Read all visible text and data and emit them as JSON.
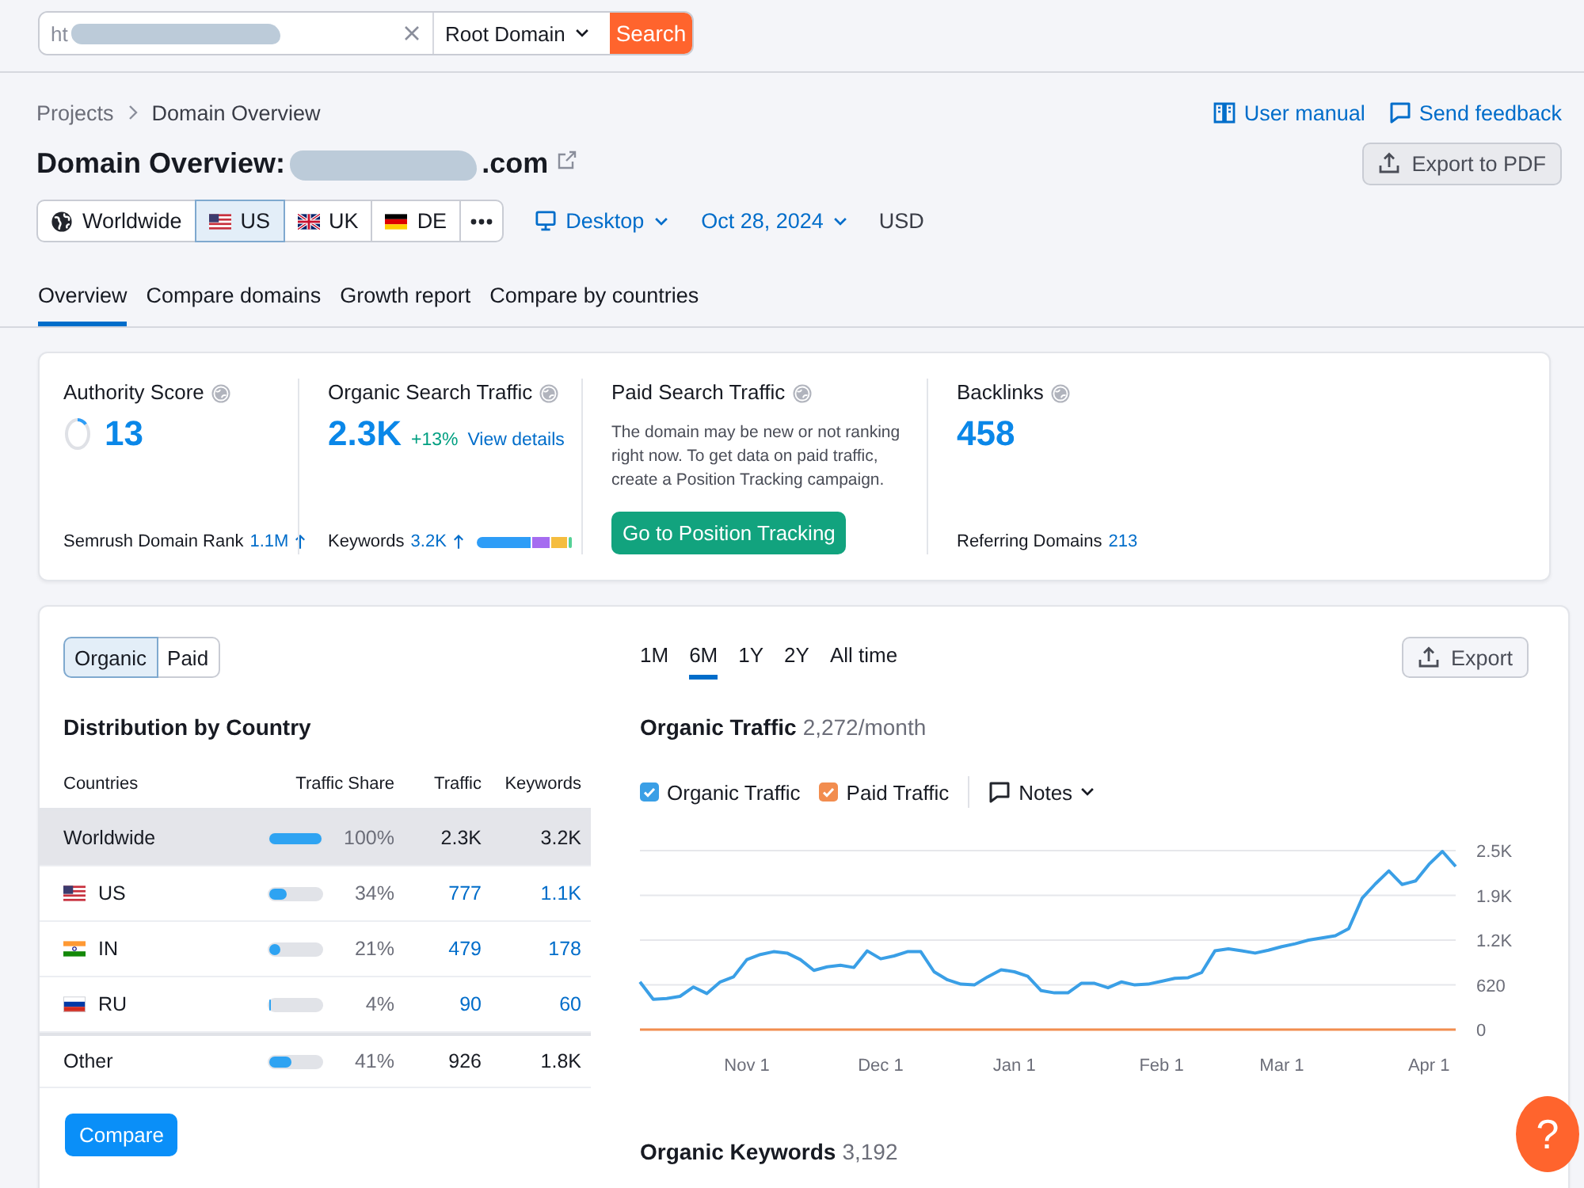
{
  "search_bar": {
    "value": "ht",
    "scope": "Root Domain",
    "button": "Search"
  },
  "header": {
    "breadcrumbs": [
      "Projects",
      "Domain Overview"
    ],
    "user_manual": "User manual",
    "send_feedback": "Send feedback",
    "export_pdf": "Export to PDF",
    "title": "Domain Overview:",
    "domain_suffix": ".com",
    "databases": [
      {
        "label": "Worldwide",
        "kind": "globe",
        "selected": false
      },
      {
        "label": "US",
        "kind": "us",
        "selected": true
      },
      {
        "label": "UK",
        "kind": "uk",
        "selected": false
      },
      {
        "label": "DE",
        "kind": "de",
        "selected": false
      }
    ],
    "device": "Desktop",
    "date": "Oct 28, 2024",
    "currency": "USD"
  },
  "tabs": [
    {
      "label": "Overview",
      "selected": true
    },
    {
      "label": "Compare domains",
      "selected": false
    },
    {
      "label": "Growth report",
      "selected": false
    },
    {
      "label": "Compare by countries",
      "selected": false
    }
  ],
  "metrics": [
    {
      "kind": "score",
      "label": "Authority Score",
      "value": "13",
      "level": 0.13,
      "footer": {
        "label": "Semrush Domain Rank",
        "value": "1.1M",
        "rising": true
      }
    },
    {
      "kind": "traffic",
      "label": "Organic Search Traffic",
      "value": "2.3K",
      "change": "+13%",
      "link": "View details",
      "footer": {
        "label": "Keywords",
        "value": "3.2K",
        "rising": true
      }
    },
    {
      "kind": "notice",
      "label": "Paid Search Traffic",
      "description": "The domain may be new or not ranking right now. To get data on paid traffic, create a Position Tracking campaign.",
      "button": "Go to Position Tracking"
    },
    {
      "kind": "count",
      "label": "Backlinks",
      "value": "458",
      "footer": {
        "label": "Referring Domains",
        "value": "213"
      }
    }
  ],
  "distribution": {
    "toggle": [
      {
        "label": "Organic",
        "selected": true
      },
      {
        "label": "Paid",
        "selected": false
      }
    ],
    "title": "Distribution by Country",
    "columns": [
      "Countries",
      "Traffic Share",
      "Traffic",
      "Keywords"
    ],
    "rows": [
      {
        "kind": "total",
        "country": "Worldwide",
        "level": 1.0,
        "share": "100%",
        "traffic": "2.3K",
        "keywords": "3.2K",
        "selected": true
      },
      {
        "kind": "us",
        "country": "US",
        "level": 0.34,
        "share": "34%",
        "traffic": "777",
        "keywords": "1.1K",
        "selected": false
      },
      {
        "kind": "in",
        "country": "IN",
        "level": 0.21,
        "share": "21%",
        "traffic": "479",
        "keywords": "178",
        "selected": false
      },
      {
        "kind": "ru",
        "country": "RU",
        "level": 0.04,
        "share": "4%",
        "traffic": "90",
        "keywords": "60",
        "selected": false
      },
      {
        "kind": "other",
        "country": "Other",
        "level": 0.41,
        "share": "41%",
        "traffic": "926",
        "keywords": "1.8K",
        "selected": false
      }
    ],
    "compare_button": "Compare"
  },
  "traffic_panel": {
    "periods": [
      {
        "label": "1M",
        "selected": false
      },
      {
        "label": "6M",
        "selected": true
      },
      {
        "label": "1Y",
        "selected": false
      },
      {
        "label": "2Y",
        "selected": false
      },
      {
        "label": "All time",
        "selected": false
      }
    ],
    "export": "Export",
    "title": "Organic Traffic",
    "summary": "2,272/month",
    "legend": [
      {
        "checked": true
      },
      {
        "checked": true
      }
    ],
    "notes": "Notes",
    "chart_data": {
      "type": "line",
      "grid": true,
      "categories": [
        null,
        null,
        null,
        null,
        null,
        null,
        null,
        null,
        "Nov 1",
        null,
        null,
        null,
        null,
        null,
        null,
        null,
        null,
        null,
        "Dec 1",
        null,
        null,
        null,
        null,
        null,
        null,
        null,
        null,
        null,
        "Jan 1",
        null,
        null,
        null,
        null,
        null,
        null,
        null,
        null,
        null,
        null,
        "Feb 1",
        null,
        null,
        null,
        null,
        null,
        null,
        null,
        null,
        "Mar 1",
        null,
        null,
        null,
        null,
        null,
        null,
        null,
        null,
        null,
        null,
        "Apr 1",
        null,
        null
      ],
      "series": [
        {
          "name": "Organic Traffic",
          "color": "#3a9fe6",
          "values": [
            660,
            420,
            430,
            460,
            590,
            500,
            660,
            730,
            970,
            1040,
            1080,
            1060,
            970,
            820,
            870,
            890,
            860,
            1090,
            980,
            1020,
            1080,
            1080,
            800,
            690,
            630,
            620,
            730,
            830,
            800,
            740,
            540,
            510,
            510,
            640,
            640,
            580,
            660,
            620,
            630,
            670,
            710,
            720,
            790,
            1090,
            1120,
            1090,
            1060,
            1100,
            1150,
            1190,
            1240,
            1270,
            1300,
            1400,
            1820,
            2020,
            2200,
            2010,
            2060,
            2290,
            2470,
            2260
          ]
        },
        {
          "name": "Paid Traffic",
          "color": "#f28d4f",
          "values": [
            0,
            0,
            0,
            0,
            0,
            0,
            0,
            0,
            0,
            0,
            0,
            0,
            0,
            0,
            0,
            0,
            0,
            0,
            0,
            0,
            0,
            0,
            0,
            0,
            0,
            0,
            0,
            0,
            0,
            0,
            0,
            0,
            0,
            0,
            0,
            0,
            0,
            0,
            0,
            0,
            0,
            0,
            0,
            0,
            0,
            0,
            0,
            0,
            0,
            0,
            0,
            0,
            0,
            0,
            0,
            0,
            0,
            0,
            0,
            0,
            0,
            0
          ]
        }
      ],
      "ylim": [
        0,
        2480
      ],
      "yticks": [
        {
          "value": 0,
          "label": "0"
        },
        {
          "value": 620,
          "label": "620"
        },
        {
          "value": 1240,
          "label": "1.2K"
        },
        {
          "value": 1860,
          "label": "1.9K"
        },
        {
          "value": 2480,
          "label": "2.5K"
        }
      ]
    }
  },
  "keywords_section": {
    "title": "Organic Keywords",
    "summary": "3,192"
  },
  "help_button": "?"
}
